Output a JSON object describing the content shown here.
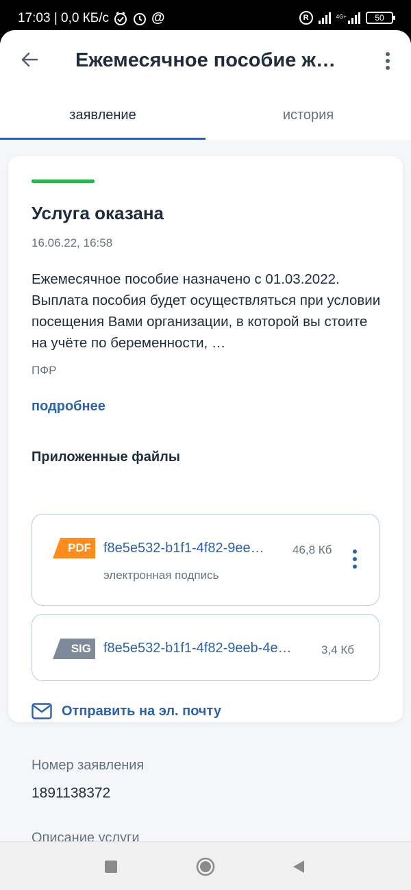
{
  "status_bar": {
    "time_speed": "17:03 | 0,0 КБ/с",
    "net_label": "4G+",
    "battery": "50"
  },
  "header": {
    "title": "Ежемесячное пособие ж…"
  },
  "tabs": [
    {
      "label": "заявление",
      "active": true
    },
    {
      "label": "история",
      "active": false
    }
  ],
  "card": {
    "status_title": "Услуга оказана",
    "date": "16.06.22, 16:58",
    "message": "Ежемесячное пособие назначено с 01.03.2022. Выплата пособия будет осуществляться при условии посещения Вами организации, в которой вы стоите на учёте по беременности, …",
    "agency": "ПФР",
    "more_link": "подробнее",
    "files_title": "Приложенные файлы",
    "files": [
      {
        "badge": "PDF",
        "name": "f8e5e532-b1f1-4f82-9ee…",
        "size": "46,8 Кб",
        "subtitle": "электронная подпись"
      },
      {
        "badge": "SIG",
        "name": "f8e5e532-b1f1-4f82-9eeb-4e…",
        "size": "3,4 Кб"
      }
    ],
    "send_email": "Отправить на эл. почту"
  },
  "details": {
    "number_label": "Номер заявления",
    "number_value": "1891138372",
    "description_label": "Описание услуги"
  },
  "colors": {
    "accent": "#2b62ab",
    "success": "#2db84d",
    "pdf": "#ff8b1a",
    "sig": "#7e8a99"
  }
}
